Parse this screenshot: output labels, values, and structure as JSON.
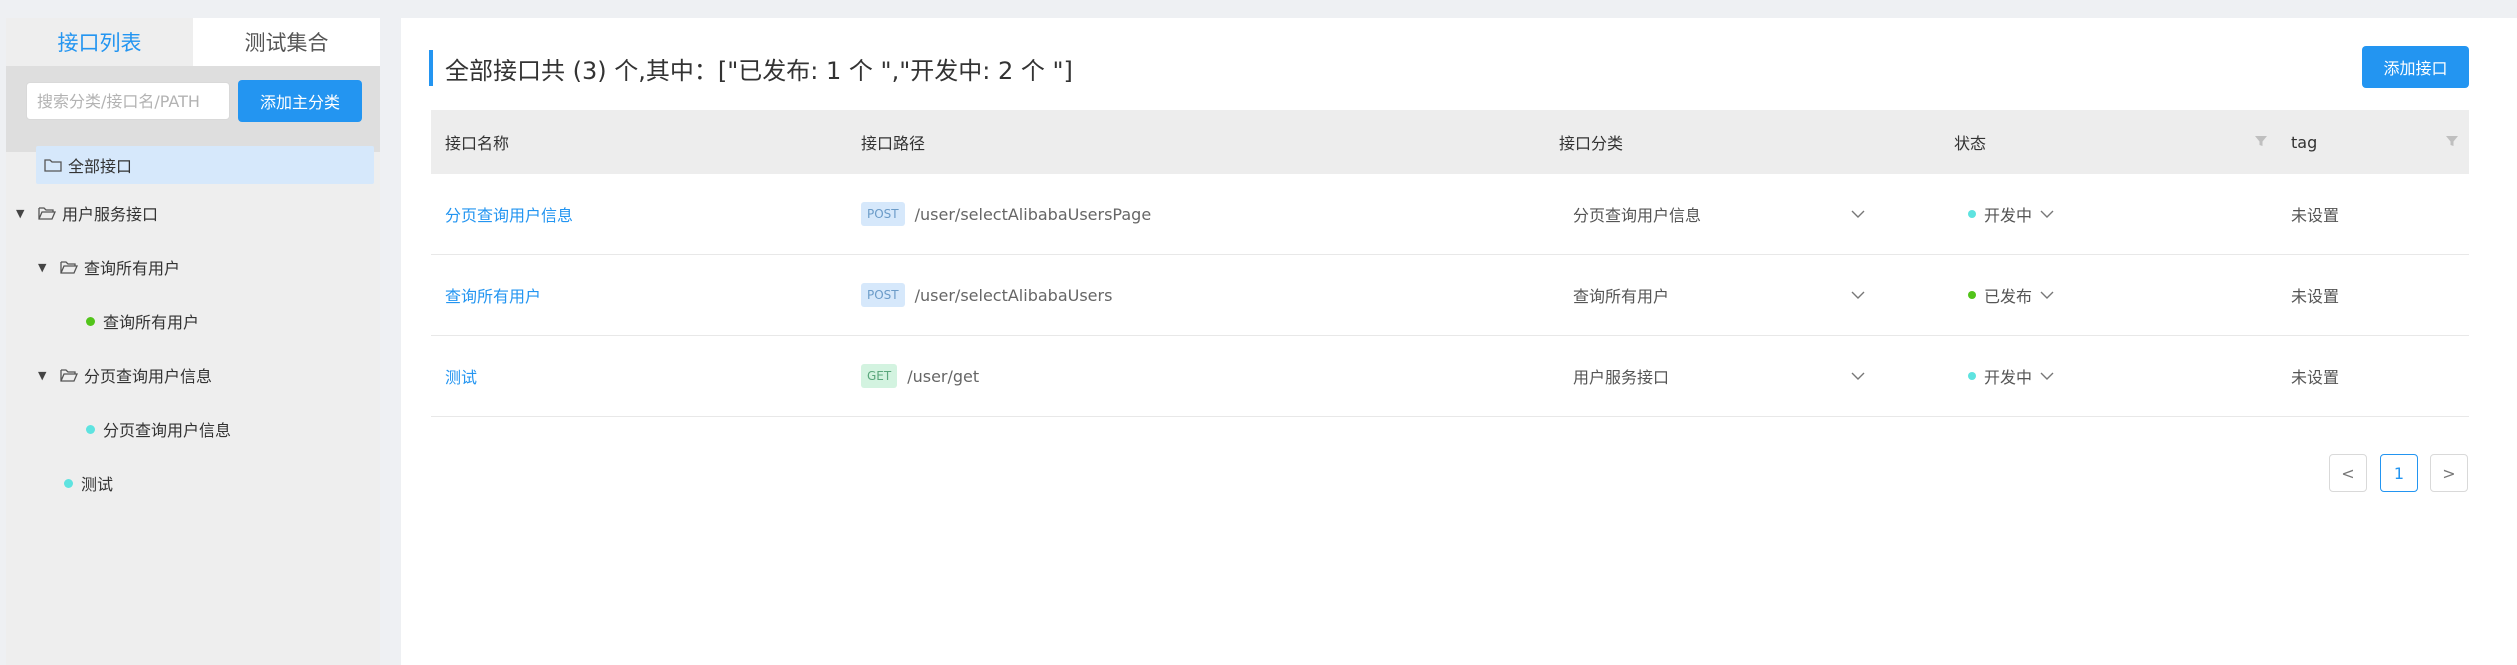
{
  "sidebar": {
    "tabs": [
      {
        "label": "接口列表",
        "active": true
      },
      {
        "label": "测试集合",
        "active": false
      }
    ],
    "search": {
      "placeholder": "搜索分类/接口名/PATH",
      "value": ""
    },
    "add_category_label": "添加主分类",
    "tree": {
      "all": "全部接口",
      "group": "用户服务接口",
      "sub1": "查询所有用户",
      "sub1_child": "查询所有用户",
      "sub2": "分页查询用户信息",
      "sub2_child": "分页查询用户信息",
      "leaf": "测试"
    }
  },
  "main": {
    "title": "全部接口共 (3) 个,其中：[\"已发布: 1 个 \",\"开发中: 2 个 \"]",
    "add_api_label": "添加接口",
    "columns": [
      "接口名称",
      "接口路径",
      "接口分类",
      "状态",
      "tag"
    ],
    "rows": [
      {
        "name": "分页查询用户信息",
        "method": "POST",
        "path": "/user/selectAlibabaUsersPage",
        "category": "分页查询用户信息",
        "status": "开发中",
        "tag": "未设置"
      },
      {
        "name": "查询所有用户",
        "method": "POST",
        "path": "/user/selectAlibabaUsers",
        "category": "查询所有用户",
        "status": "已发布",
        "tag": "未设置"
      },
      {
        "name": "测试",
        "method": "GET",
        "path": "/user/get",
        "category": "用户服务接口",
        "status": "开发中",
        "tag": "未设置"
      }
    ],
    "pagination": {
      "prev": "<",
      "current": "1",
      "next": ">"
    }
  },
  "colors": {
    "accent": "#2395f1",
    "status_dev": "#5ee3e0",
    "status_done": "#52c41a",
    "method_post_bg": "#d6e8fb",
    "method_get_bg": "#d3f3e0"
  },
  "icons": [
    "folder-icon",
    "caret-down-icon",
    "filter-icon",
    "chevron-down-icon"
  ]
}
